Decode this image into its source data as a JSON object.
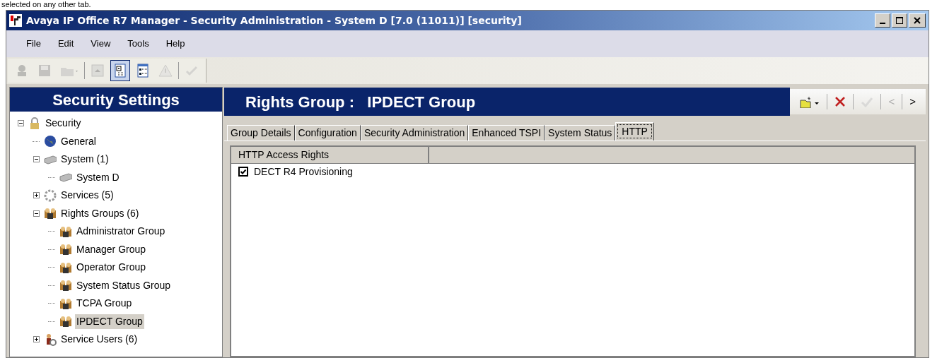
{
  "caption": "selected on any other tab.",
  "window": {
    "title": "Avaya IP Office R7 Manager - Security Administration - System D [7.0 (11011)] [security]"
  },
  "menu": [
    "File",
    "Edit",
    "View",
    "Tools",
    "Help"
  ],
  "toolbar": [
    {
      "kind": "user",
      "disabled": true,
      "pressed": false
    },
    {
      "kind": "save",
      "disabled": true,
      "pressed": false
    },
    {
      "kind": "open",
      "disabled": true,
      "pressed": false
    },
    {
      "kind": "sep"
    },
    {
      "kind": "up",
      "disabled": true,
      "pressed": false
    },
    {
      "kind": "tree-view",
      "disabled": false,
      "pressed": true
    },
    {
      "kind": "list-view",
      "disabled": false,
      "pressed": false
    },
    {
      "kind": "warning",
      "disabled": true,
      "pressed": false
    },
    {
      "kind": "sep"
    },
    {
      "kind": "check",
      "disabled": true,
      "pressed": false
    }
  ],
  "sidebar": {
    "title": "Security Settings",
    "tree": [
      {
        "label": "Security",
        "kind": "lock",
        "expanded": true,
        "selected": false,
        "children": [
          {
            "label": "General",
            "kind": "globe",
            "selected": false
          },
          {
            "label": "System (1)",
            "kind": "server",
            "expanded": true,
            "selected": false,
            "children": [
              {
                "label": "System D",
                "kind": "server",
                "selected": false
              }
            ]
          },
          {
            "label": "Services (5)",
            "kind": "gear",
            "expanded": false,
            "selected": false
          },
          {
            "label": "Rights Groups (6)",
            "kind": "group",
            "expanded": true,
            "selected": false,
            "children": [
              {
                "label": "Administrator Group",
                "kind": "group",
                "selected": false
              },
              {
                "label": "Manager Group",
                "kind": "group",
                "selected": false
              },
              {
                "label": "Operator Group",
                "kind": "group",
                "selected": false
              },
              {
                "label": "System Status Group",
                "kind": "group",
                "selected": false
              },
              {
                "label": "TCPA Group",
                "kind": "group",
                "selected": false
              },
              {
                "label": "IPDECT Group",
                "kind": "group",
                "selected": true
              }
            ]
          },
          {
            "label": "Service Users (6)",
            "kind": "users",
            "expanded": false,
            "selected": false
          }
        ]
      }
    ]
  },
  "panel": {
    "title": "Rights Group :   IPDECT Group",
    "actions": [
      {
        "kind": "new",
        "disabled": false
      },
      {
        "kind": "delete",
        "disabled": false
      },
      {
        "kind": "check",
        "disabled": true
      },
      {
        "kind": "text",
        "label": "<",
        "disabled": true
      },
      {
        "kind": "text",
        "label": ">",
        "disabled": false
      }
    ],
    "tabs": [
      {
        "label": "Group Details",
        "selected": false
      },
      {
        "label": "Configuration",
        "selected": false
      },
      {
        "label": "Security Administration",
        "selected": false
      },
      {
        "label": "Enhanced TSPI",
        "selected": false
      },
      {
        "label": "System Status",
        "selected": false
      },
      {
        "label": "HTTP",
        "selected": true
      }
    ],
    "table": {
      "columns": [
        "HTTP Access Rights"
      ],
      "rows": [
        {
          "label": "DECT R4 Provisioning",
          "checked": true
        }
      ]
    }
  }
}
